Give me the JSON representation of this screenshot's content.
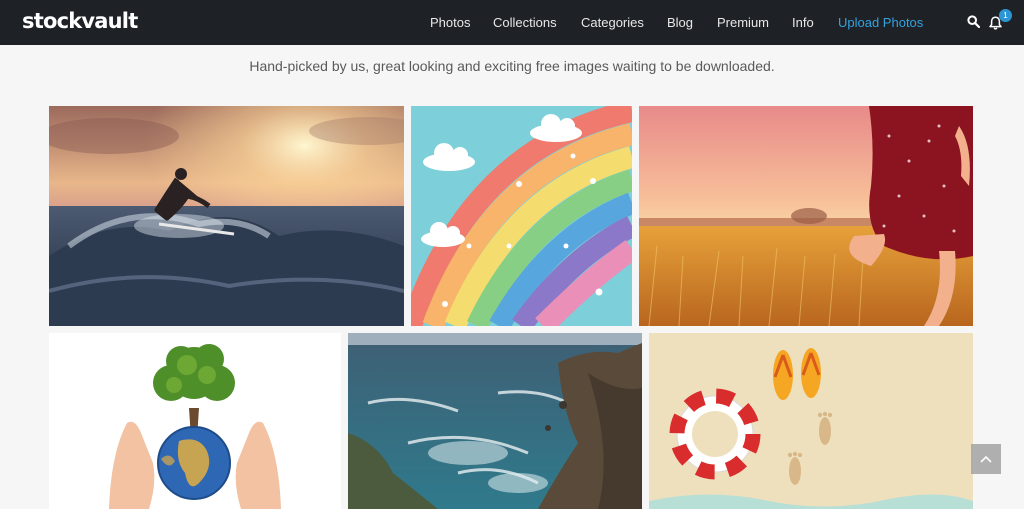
{
  "brand": {
    "logo_text": "stockvault"
  },
  "nav": {
    "items": [
      {
        "label": "Photos"
      },
      {
        "label": "Collections"
      },
      {
        "label": "Categories"
      },
      {
        "label": "Blog"
      },
      {
        "label": "Premium"
      },
      {
        "label": "Info"
      },
      {
        "label": "Upload Photos"
      }
    ],
    "notification_count": "1"
  },
  "tagline": "Hand-picked by us, great looking and exciting free images waiting to be downloaded.",
  "colors": {
    "nav_bg": "#1e2126",
    "accent": "#33a3de",
    "page_bg": "#f6f6f6",
    "badge": "#2c96d4"
  },
  "icons": [
    "search-icon",
    "bell-icon",
    "chevron-up-icon"
  ]
}
